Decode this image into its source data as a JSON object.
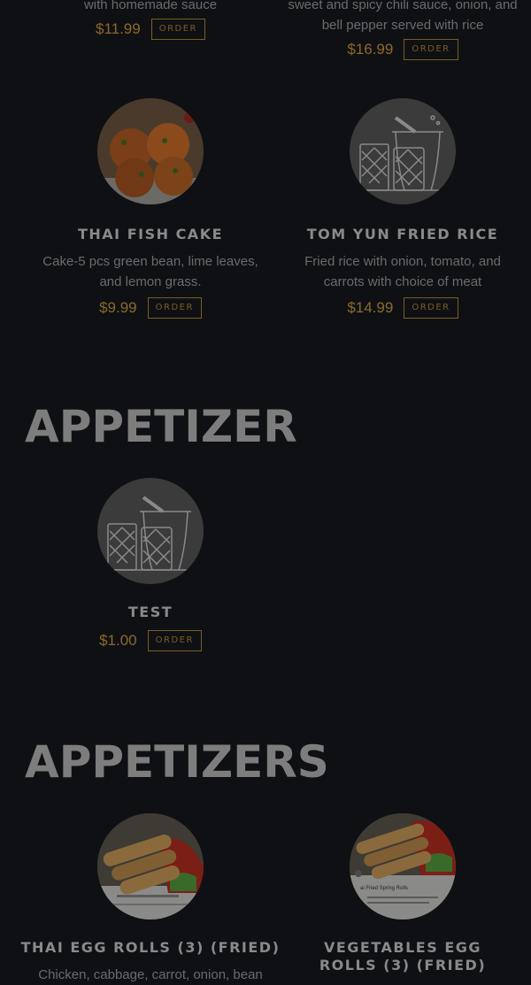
{
  "top_items": [
    {
      "desc": "with homemade sauce",
      "price": "$11.99",
      "order": "ORDER"
    },
    {
      "desc": "sweet and spicy chili sauce, onion, and bell pepper served with rice",
      "price": "$16.99",
      "order": "ORDER"
    }
  ],
  "row2": [
    {
      "name": "THAI FISH CAKE",
      "desc": "Cake-5 pcs green bean, lime leaves, and lemon grass.",
      "price": "$9.99",
      "order": "ORDER",
      "image": "fish-cake-photo"
    },
    {
      "name": "TOM YUN FRIED RICE",
      "desc": "Fried rice with onion, tomato, and carrots with choice of meat",
      "price": "$14.99",
      "order": "ORDER",
      "image": "mortar-pestle-placeholder-icon"
    }
  ],
  "sections": [
    {
      "title": "APPETIZER",
      "items": [
        {
          "name": "TEST",
          "price": "$1.00",
          "order": "ORDER",
          "image": "mortar-pestle-placeholder-icon"
        }
      ]
    },
    {
      "title": "APPETIZERS",
      "items": [
        {
          "name": "THAI EGG ROLLS (3) (FRIED)",
          "desc": "Chicken, cabbage, carrot, onion, bean",
          "image": "egg-rolls-photo"
        },
        {
          "name": "VEGETABLES EGG ROLLS (3) (FRIED)",
          "image": "egg-rolls-photo",
          "photo_caption": "ai Fried Spring Rolls"
        }
      ]
    }
  ],
  "colors": {
    "background": "#0f1014",
    "accent": "#8a6a2a",
    "text": "#6b6b6b",
    "heading": "#7d7d7d"
  }
}
